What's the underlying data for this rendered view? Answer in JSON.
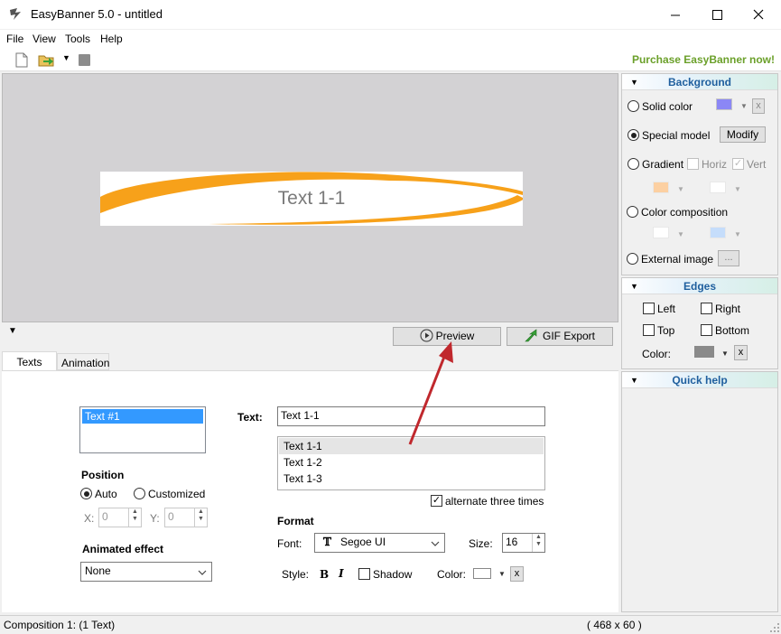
{
  "window": {
    "title": "EasyBanner 5.0 - untitled"
  },
  "menu": {
    "items": [
      "File",
      "View",
      "Tools",
      "Help"
    ]
  },
  "toolbar": {
    "purchase": "Purchase EasyBanner now!"
  },
  "banner": {
    "text": "Text 1-1",
    "dimensions": "( 468 x 60 )"
  },
  "actions": {
    "preview": "Preview",
    "gif_export": "GIF Export"
  },
  "tabs": [
    {
      "label": "Texts"
    },
    {
      "label": "Animation"
    }
  ],
  "texts_tab": {
    "text_list": [
      "Text #1"
    ],
    "position": {
      "title": "Position",
      "auto": "Auto",
      "customized": "Customized",
      "x_label": "X:",
      "x_value": "0",
      "y_label": "Y:",
      "y_value": "0"
    },
    "animated_effect": {
      "title": "Animated effect",
      "value": "None"
    },
    "text": {
      "label": "Text:",
      "value": "Text 1-1",
      "lines": [
        "Text 1-1",
        "Text 1-2",
        "Text 1-3"
      ],
      "alternate_label": "alternate three times"
    },
    "format": {
      "title": "Format",
      "font_label": "Font:",
      "font_value": "Segoe UI",
      "size_label": "Size:",
      "size_value": "16",
      "style_label": "Style:",
      "bold": "B",
      "italic": "I",
      "shadow": "Shadow",
      "color_label": "Color:",
      "clear": "x",
      "color": "#8a8a8a"
    }
  },
  "background": {
    "title": "Background",
    "solid_color": "Solid color",
    "special_model": "Special model",
    "modify": "Modify",
    "gradient": "Gradient",
    "horiz": "Horiz",
    "vert": "Vert",
    "color_composition": "Color composition",
    "external_image": "External image",
    "ellipsis": "...",
    "clear": "x",
    "solid_swatch": "#8b87f5",
    "gradient_colors": [
      "#fcd0a2",
      "#ffffff"
    ],
    "composition_colors": [
      "#ffffff",
      "#c5ddfb"
    ]
  },
  "edges": {
    "title": "Edges",
    "left": "Left",
    "right": "Right",
    "top": "Top",
    "bottom": "Bottom",
    "color_label": "Color:",
    "clear": "x",
    "color": "#8a8a8a"
  },
  "quick_help": {
    "title": "Quick help"
  },
  "status": {
    "composition": "Composition 1:  (1 Text)",
    "size": "( 468 x 60 )"
  },
  "colors": {
    "accent_orange": "#f7a11a",
    "purchase_green": "#6ba02a",
    "header_blue": "#1f5f9e"
  }
}
